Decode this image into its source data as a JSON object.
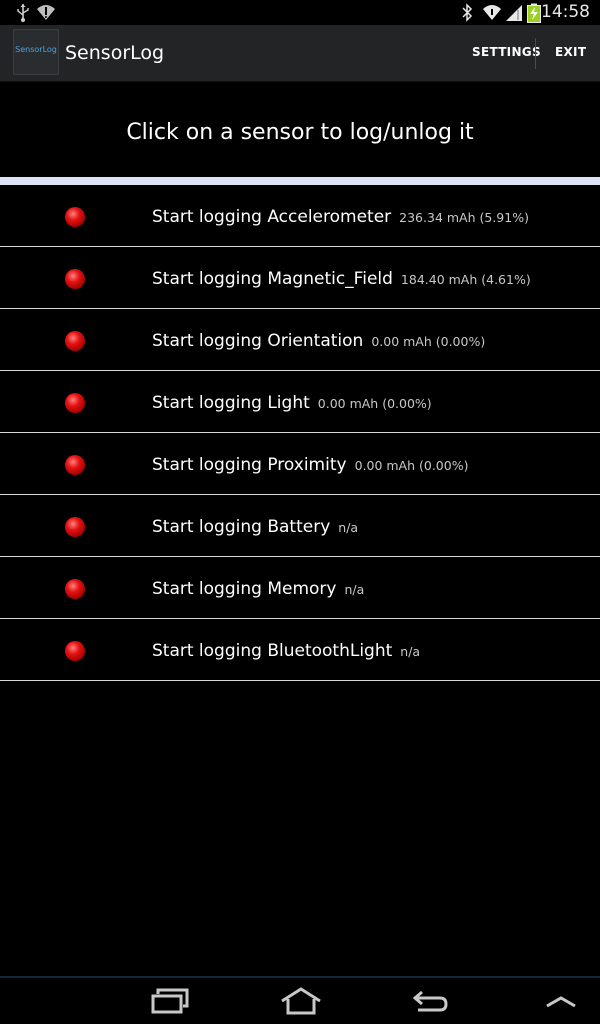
{
  "status_bar": {
    "time": "14:58",
    "icons": [
      "usb-icon",
      "wifi-signal-icon",
      "bluetooth-icon",
      "wifi-icon",
      "cell-signal-icon",
      "battery-charging-icon"
    ]
  },
  "action_bar": {
    "logo_text": "SensorLog",
    "title": "SensorLog",
    "settings_label": "SETTINGS",
    "exit_label": "EXIT"
  },
  "header": {
    "instruction": "Click on a sensor to log/unlog it"
  },
  "sensors": [
    {
      "label": "Start logging Accelerometer",
      "power": "236.34 mAh (5.91%)",
      "status_color": "#d00000"
    },
    {
      "label": "Start logging Magnetic_Field",
      "power": "184.40 mAh (4.61%)",
      "status_color": "#d00000"
    },
    {
      "label": "Start logging Orientation",
      "power": "0.00 mAh (0.00%)",
      "status_color": "#d00000"
    },
    {
      "label": "Start logging Light",
      "power": "0.00 mAh (0.00%)",
      "status_color": "#d00000"
    },
    {
      "label": "Start logging Proximity",
      "power": "0.00 mAh (0.00%)",
      "status_color": "#d00000"
    },
    {
      "label": "Start logging Battery",
      "power": "n/a",
      "status_color": "#d00000"
    },
    {
      "label": "Start logging Memory",
      "power": "n/a",
      "status_color": "#d00000"
    },
    {
      "label": "Start logging BluetoothLight",
      "power": "n/a",
      "status_color": "#d00000"
    }
  ],
  "colors": {
    "action_bar_bg": "#222426",
    "accent_strip": "#dde3f8",
    "divider": "#d8d8d8"
  }
}
